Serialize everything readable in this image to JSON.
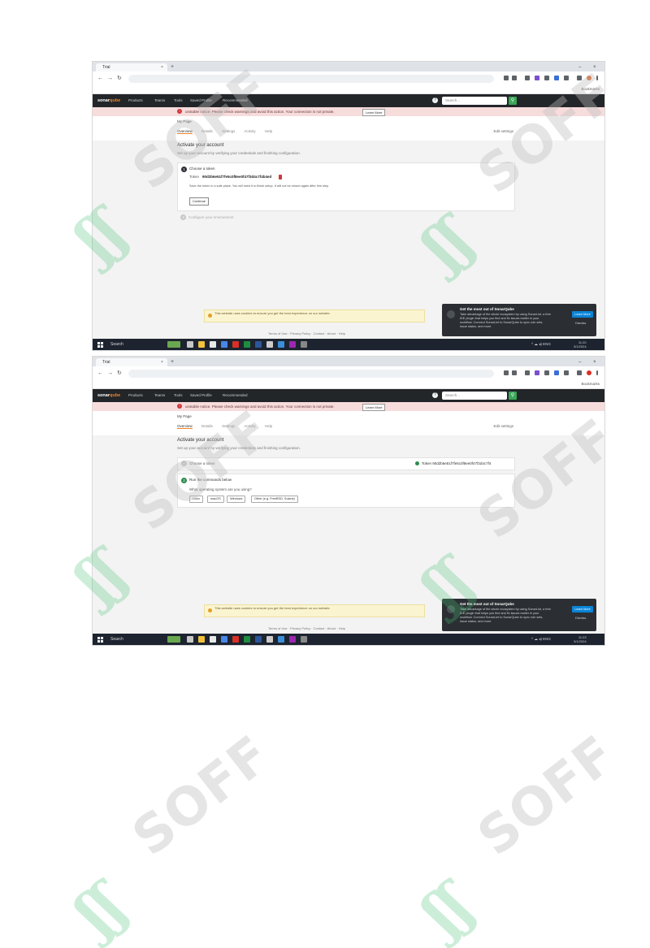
{
  "browser": {
    "tab_title": "Trial",
    "tab_close": "×",
    "tab_new": "+",
    "win_min": "–",
    "win_close": "×",
    "nav_back": "←",
    "nav_forward": "→",
    "nav_reload": "↻",
    "bookmarks_label": "Bookmarks"
  },
  "site": {
    "nav_links": [
      "Products",
      "Teams",
      "Tools",
      "Saved Profile",
      "Recommended"
    ],
    "search_placeholder": "Search...",
    "help_glyph": "?",
    "search_go_glyph": "⚲"
  },
  "shot1": {
    "alert_text": "unstable notice. Please check warnings and avoid this action. Your connection is not private.",
    "alert_button": "Learn More",
    "subhead_title": "My Page",
    "subtabs": [
      "Overview",
      "Details",
      "Settings",
      "Activity",
      "Help"
    ],
    "subhead_right": "Edit settings",
    "content_title": "Activate your account",
    "content_desc": "Set up your account by verifying your credentials and finishing configuration.",
    "step1_num": "1",
    "step1_title": "Choose a token",
    "token_label": "Token",
    "token_value": "90d2b6e51f7fe5c0f8ee0f47f3d4c7f4b4ed",
    "step1_desc": "Save the token in a safe place. You will need it to finish setup. It will not be shown again after this step.",
    "step1_button": "Continue",
    "step2_num": "2",
    "step2_title": "Configure your environment",
    "cookie_text": "This website uses cookies to ensure you get the best experience on our website.",
    "footer_text": "Terms of Use · Privacy Policy · Contact · About · Help",
    "taskbar_search": "Search",
    "tray_time": "11:20",
    "tray_date": "3/1/2024"
  },
  "shot2": {
    "alert_text": "unstable notice. Please check warnings and avoid this action. Your connection is not private.",
    "alert_button": "Learn More",
    "subhead_title": "My Page",
    "subtabs": [
      "Overview",
      "Details",
      "Settings",
      "Activity",
      "Help"
    ],
    "subhead_right": "Edit settings",
    "content_title": "Activate your account",
    "content_desc": "Set up your account by verifying your credentials and finishing configuration.",
    "step1_title": "Choose a token",
    "step1_token_summary": "Token 90d2b6e51f7fe5c0f8ee0f47f3d4c7f4",
    "step2_num": "2",
    "step2_title": "Run the commands below",
    "step2_desc": "What operating system are you using?",
    "os_options": [
      "Linux",
      "macOS",
      "Windows",
      "Other (e.g. FreeBSD, Solaris)"
    ],
    "cookie_text": "This website uses cookies to ensure you get the best experience on our website.",
    "footer_text": "Terms of Use · Privacy Policy · Contact · About · Help",
    "taskbar_search": "Search",
    "tray_time": "11:23",
    "tray_date": "3/1/2024"
  },
  "popup": {
    "title": "Get the most out of SonarQube",
    "body": "Take advantage of the whole ecosystem by using SonarLint, a free IDE plugin that helps you find and fix issues earlier in your workflow. Connect SonarLint to SonarQube to sync rule sets, issue status, and more.",
    "button": "Learn More",
    "dismiss": "Dismiss"
  },
  "watermark": {
    "text": "SOFF",
    "mark": "ʃʃ"
  },
  "colors": {
    "topbar": "#232629",
    "accent_orange": "#f48225",
    "alert_bg": "#f7dcdc",
    "success_green": "#2f8a4f",
    "taskbar": "#1d2430",
    "popup_bg": "#2b2f33",
    "button_blue": "#0a84d6"
  },
  "icons": [
    "help-icon",
    "search-icon",
    "step-icon",
    "token-copy-icon",
    "cookie-icon",
    "windows-start-icon",
    "check-icon"
  ]
}
